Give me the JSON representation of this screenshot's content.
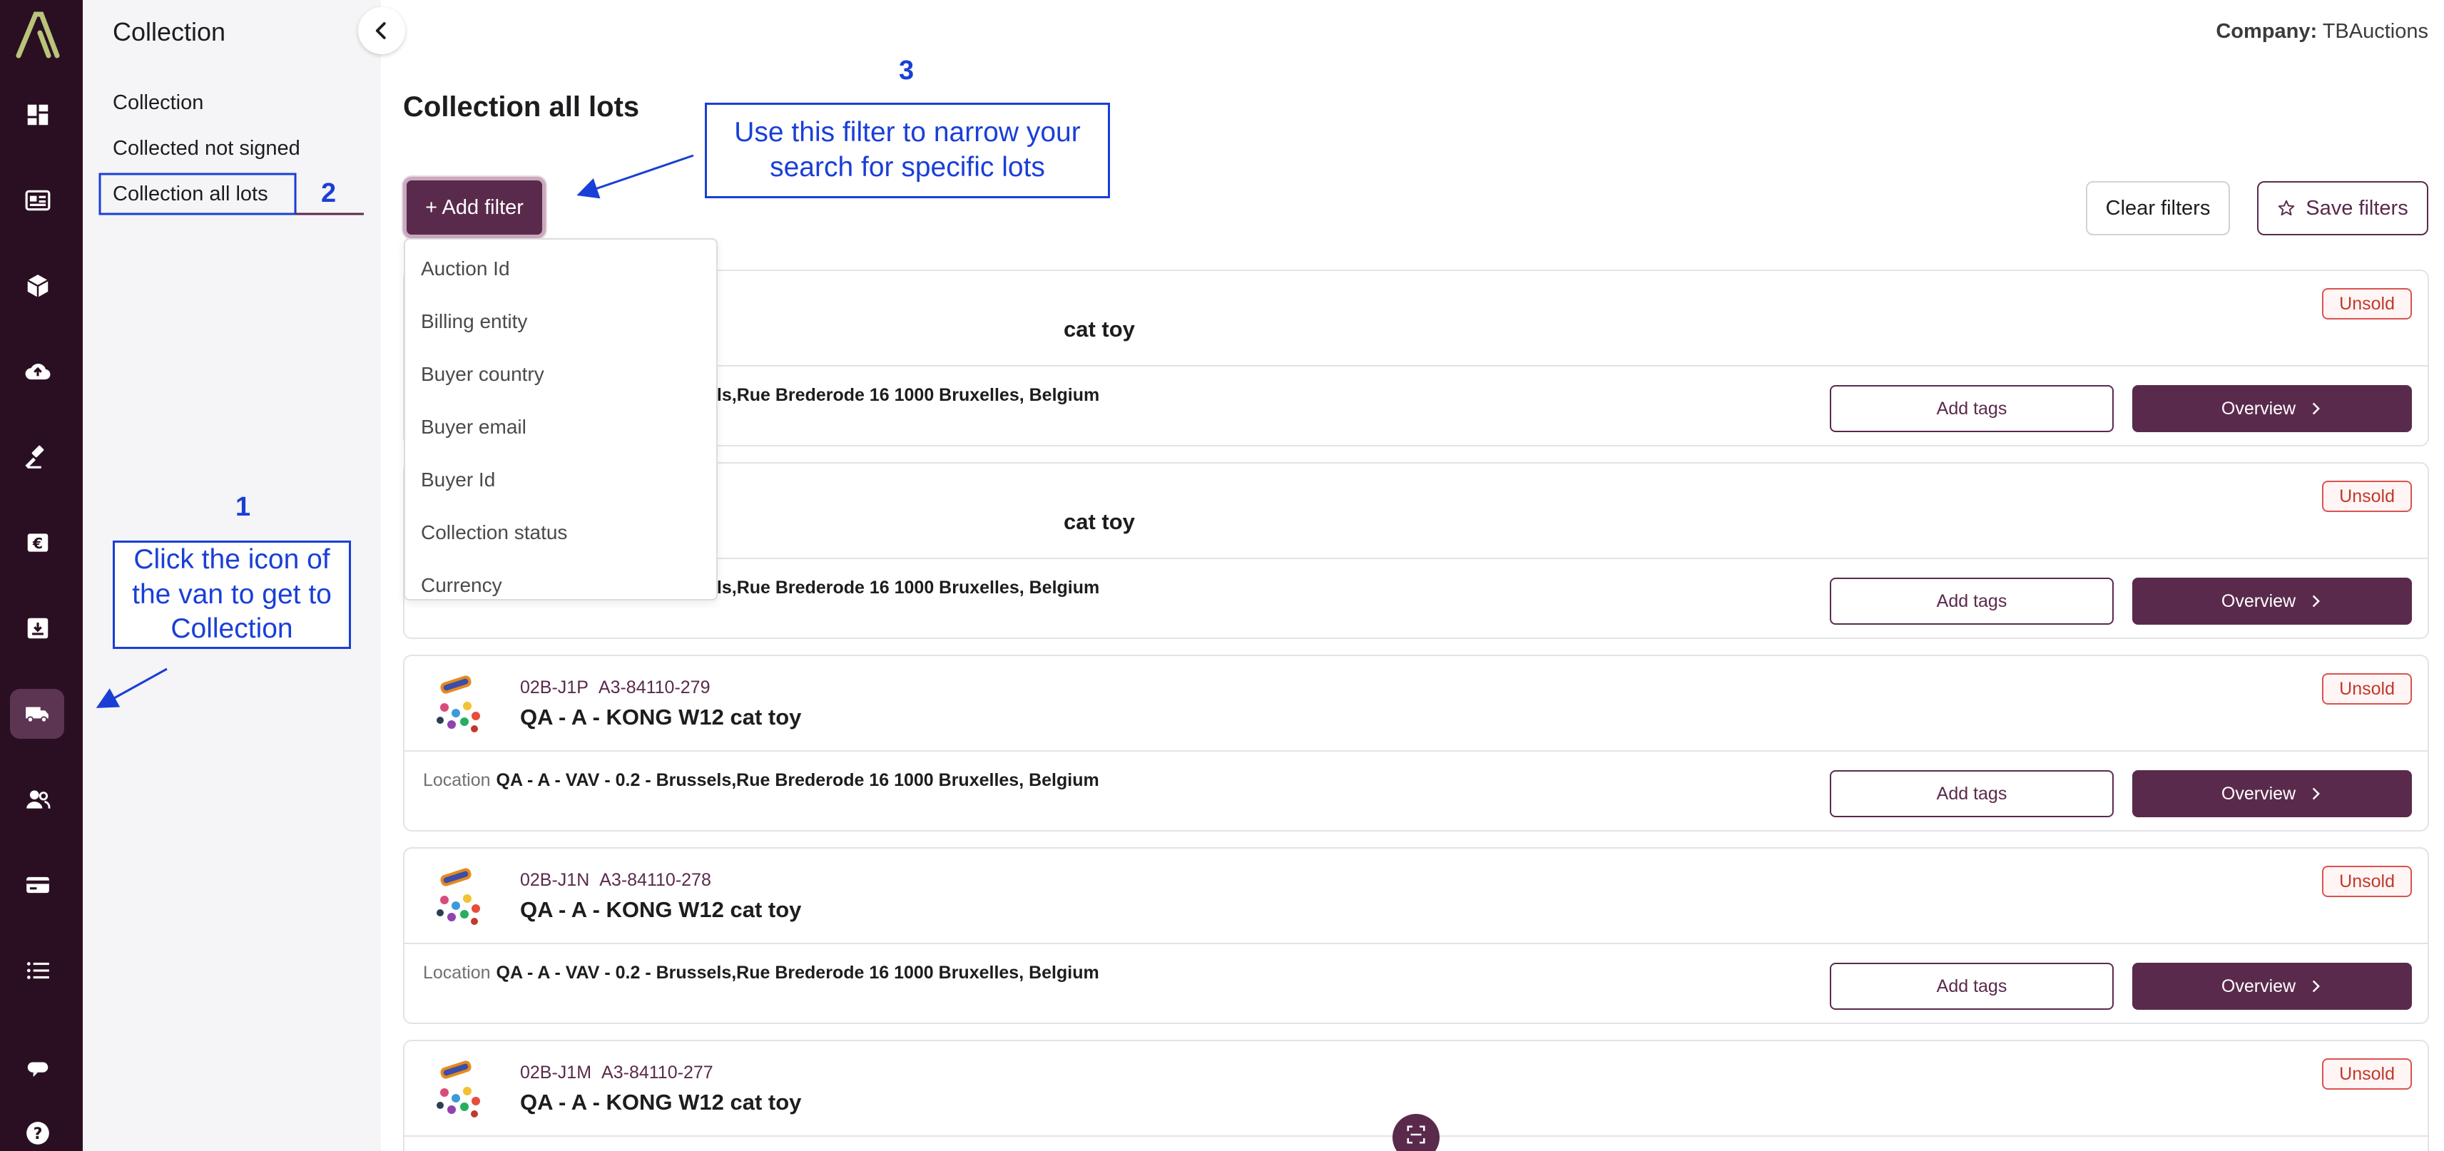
{
  "app": {
    "company_label": "Company:",
    "company_name": "TBAuctions"
  },
  "rail": {
    "icons": [
      "logo-icon",
      "dashboard-icon",
      "listing-icon",
      "box-icon",
      "upload-icon",
      "gavel-icon",
      "euro-icon",
      "download-icon",
      "van-icon",
      "users-icon",
      "card-icon",
      "list-icon",
      "chat-icon",
      "help-icon"
    ],
    "active": "van-icon"
  },
  "subnav": {
    "title": "Collection",
    "items": [
      "Collection",
      "Collected not signed",
      "Collection all lots"
    ],
    "active_index": 2
  },
  "main": {
    "title": "Collection all lots",
    "add_filter_label": "+ Add filter",
    "clear_filters_label": "Clear filters",
    "save_filters_label": "Save filters"
  },
  "filter_dropdown": {
    "options": [
      "Auction Id",
      "Billing entity",
      "Buyer country",
      "Buyer email",
      "Buyer Id",
      "Collection status",
      "Currency"
    ]
  },
  "lots": [
    {
      "code": "",
      "ref": "",
      "name": "cat toy",
      "status": "Unsold",
      "location_label": "",
      "location": "els,Rue Brederode 16 1000 Bruxelles, Belgium",
      "add_tags_label": "Add tags",
      "overview_label": "Overview"
    },
    {
      "code": "",
      "ref": "",
      "name": "cat toy",
      "status": "Unsold",
      "location_label": "",
      "location": "els,Rue Brederode 16 1000 Bruxelles, Belgium",
      "add_tags_label": "Add tags",
      "overview_label": "Overview"
    },
    {
      "code": "02B-J1P",
      "ref": "A3-84110-279",
      "name": "QA - A - KONG W12 cat toy",
      "status": "Unsold",
      "location_label": "Location",
      "location": "QA - A - VAV - 0.2 - Brussels,Rue Brederode 16 1000 Bruxelles, Belgium",
      "add_tags_label": "Add tags",
      "overview_label": "Overview"
    },
    {
      "code": "02B-J1N",
      "ref": "A3-84110-278",
      "name": "QA - A - KONG W12 cat toy",
      "status": "Unsold",
      "location_label": "Location",
      "location": "QA - A - VAV - 0.2 - Brussels,Rue Brederode 16 1000 Bruxelles, Belgium",
      "add_tags_label": "Add tags",
      "overview_label": "Overview"
    },
    {
      "code": "02B-J1M",
      "ref": "A3-84110-277",
      "name": "QA - A - KONG W12 cat toy",
      "status": "Unsold",
      "location_label": "",
      "location": "",
      "add_tags_label": "",
      "overview_label": ""
    }
  ],
  "annotations": {
    "step1_number": "1",
    "step1_text": "Click the icon of the van to get to Collection",
    "step2_number": "2",
    "step3_number": "3",
    "step3_text": "Use this filter to narrow your search for specific lots",
    "color": "#1a3fd6"
  },
  "colors": {
    "rail_bg": "#2a0f22",
    "brand": "#5a2a4c",
    "unsold": "#c0392b"
  }
}
